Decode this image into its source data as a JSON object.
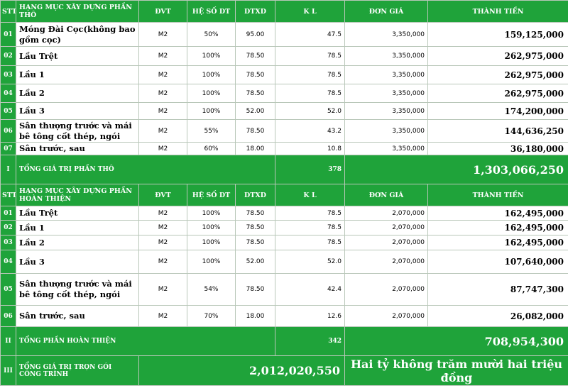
{
  "headers": {
    "stt": "STT",
    "hang_muc_tho": "HẠNG MỤC XÂY DỰNG PHẦN THÔ",
    "hang_muc_ht": "HẠNG MỤC XÂY DỰNG PHẦN HOÀN THIỆN",
    "dvt": "ĐVT",
    "he_so": "HỆ SỐ DT",
    "dtxd": "DTXD",
    "kl": "K L",
    "don_gia": "ĐƠN GIÁ",
    "thanh_tien": "THÀNH TIỀN"
  },
  "tho_rows": [
    {
      "stt": "01",
      "name": "Móng Đài Cọc(không bao gồm cọc)",
      "dvt": "M2",
      "heso": "50%",
      "dtxd": "95.00",
      "kl": "47.5",
      "dongia": "3,350,000",
      "thanhtien": "159,125,000"
    },
    {
      "stt": "02",
      "name": "Lầu Trệt",
      "dvt": "M2",
      "heso": "100%",
      "dtxd": "78.50",
      "kl": "78.5",
      "dongia": "3,350,000",
      "thanhtien": "262,975,000"
    },
    {
      "stt": "03",
      "name": "Lầu 1",
      "dvt": "M2",
      "heso": "100%",
      "dtxd": "78.50",
      "kl": "78.5",
      "dongia": "3,350,000",
      "thanhtien": "262,975,000"
    },
    {
      "stt": "04",
      "name": "Lầu 2",
      "dvt": "M2",
      "heso": "100%",
      "dtxd": "78.50",
      "kl": "78.5",
      "dongia": "3,350,000",
      "thanhtien": "262,975,000"
    },
    {
      "stt": "05",
      "name": "Lầu 3",
      "dvt": "M2",
      "heso": "100%",
      "dtxd": "52.00",
      "kl": "52.0",
      "dongia": "3,350,000",
      "thanhtien": "174,200,000"
    },
    {
      "stt": "06",
      "name": "Sân thượng trước và mái bê tông cốt thép, ngói",
      "dvt": "M2",
      "heso": "55%",
      "dtxd": "78.50",
      "kl": "43.2",
      "dongia": "3,350,000",
      "thanhtien": "144,636,250"
    },
    {
      "stt": "07",
      "name": "Sân trước, sau",
      "dvt": "M2",
      "heso": "60%",
      "dtxd": "18.00",
      "kl": "10.8",
      "dongia": "3,350,000",
      "thanhtien": "36,180,000"
    }
  ],
  "tho_total": {
    "stt": "I",
    "label": "TỔNG  GIÁ TRỊ PHẦN THÔ",
    "kl": "378",
    "value": "1,303,066,250"
  },
  "ht_rows": [
    {
      "stt": "01",
      "name": "Lầu Trệt",
      "dvt": "M2",
      "heso": "100%",
      "dtxd": "78.50",
      "kl": "78.5",
      "dongia": "2,070,000",
      "thanhtien": "162,495,000"
    },
    {
      "stt": "02",
      "name": "Lầu 1",
      "dvt": "M2",
      "heso": "100%",
      "dtxd": "78.50",
      "kl": "78.5",
      "dongia": "2,070,000",
      "thanhtien": "162,495,000"
    },
    {
      "stt": "03",
      "name": "Lầu 2",
      "dvt": "M2",
      "heso": "100%",
      "dtxd": "78.50",
      "kl": "78.5",
      "dongia": "2,070,000",
      "thanhtien": "162,495,000"
    },
    {
      "stt": "04",
      "name": "Lầu 3",
      "dvt": "M2",
      "heso": "100%",
      "dtxd": "52.00",
      "kl": "52.0",
      "dongia": "2,070,000",
      "thanhtien": "107,640,000"
    },
    {
      "stt": "05",
      "name": "Sân thượng trước và mái bê tông cốt thép, ngói",
      "dvt": "M2",
      "heso": "54%",
      "dtxd": "78.50",
      "kl": "42.4",
      "dongia": "2,070,000",
      "thanhtien": "87,747,300"
    },
    {
      "stt": "06",
      "name": "Sân trước, sau",
      "dvt": "M2",
      "heso": "70%",
      "dtxd": "18.00",
      "kl": "12.6",
      "dongia": "2,070,000",
      "thanhtien": "26,082,000"
    }
  ],
  "ht_total": {
    "stt": "II",
    "label": "TỔNG PHẦN HOÀN THIỆN",
    "kl": "342",
    "value": "708,954,300"
  },
  "grand_total": {
    "stt": "III",
    "label": "TỔNG GIÁ TRỊ TRỌN GÓI CÔNG TRÌNH",
    "value": "2,012,020,550",
    "in_words": "Hai tỷ không trăm mười hai triệu đồng"
  }
}
